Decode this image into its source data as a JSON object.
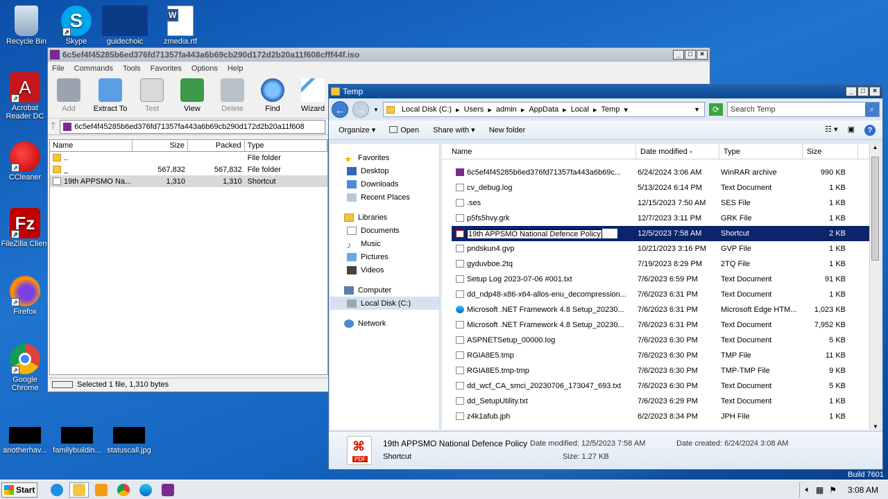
{
  "desktop": {
    "icons": [
      {
        "label": "Recycle Bin",
        "icon": "recycle-bin-icon"
      },
      {
        "label": "Skype",
        "icon": "skype-icon"
      },
      {
        "label": "guidechoic",
        "icon": "black-thumbnail"
      },
      {
        "label": "zmedia.rtf",
        "icon": "word-document-icon"
      },
      {
        "label": "Acrobat Reader DC",
        "icon": "acrobat-icon"
      },
      {
        "label": "CCleaner",
        "icon": "ccleaner-icon"
      },
      {
        "label": "FileZilla Client",
        "icon": "filezilla-icon"
      },
      {
        "label": "Firefox",
        "icon": "firefox-icon"
      },
      {
        "label": "Google Chrome",
        "icon": "chrome-icon"
      },
      {
        "label": "anotherhav...",
        "icon": "black-thumbnail"
      },
      {
        "label": "familybuildin...",
        "icon": "black-thumbnail"
      },
      {
        "label": "statuscall.jpg",
        "icon": "black-thumbnail"
      }
    ],
    "build": "Build 7601"
  },
  "winrar": {
    "title": "6c5ef4f45285b6ed376fd71357fa443a6b69cb290d172d2b20a11f608cfff44f.iso",
    "menu": [
      "File",
      "Commands",
      "Tools",
      "Favorites",
      "Options",
      "Help"
    ],
    "toolbar": [
      "Add",
      "Extract To",
      "Test",
      "View",
      "Delete",
      "Find",
      "Wizard"
    ],
    "path": "6c5ef4f45285b6ed376fd71357fa443a6b69cb290d172d2b20a11f608",
    "columns": [
      "Name",
      "Size",
      "Packed",
      "Type"
    ],
    "rows": [
      {
        "name": "..",
        "size": "",
        "packed": "",
        "type": "File folder"
      },
      {
        "name": "_",
        "size": "567,832",
        "packed": "567,832",
        "type": "File folder"
      },
      {
        "name": "19th APPSMO Na...",
        "size": "1,310",
        "packed": "1,310",
        "type": "Shortcut"
      }
    ],
    "status": "Selected 1 file, 1,310 bytes"
  },
  "explorer": {
    "title": "Temp",
    "breadcrumb": [
      "Local Disk (C:)",
      "Users",
      "admin",
      "AppData",
      "Local",
      "Temp"
    ],
    "search_placeholder": "Search Temp",
    "commands": [
      "Organize",
      "Open",
      "Share with",
      "New folder"
    ],
    "nav": {
      "favorites": "Favorites",
      "favorites_items": [
        "Desktop",
        "Downloads",
        "Recent Places"
      ],
      "libraries": "Libraries",
      "libraries_items": [
        "Documents",
        "Music",
        "Pictures",
        "Videos"
      ],
      "computer": "Computer",
      "computer_items": [
        "Local Disk (C:)"
      ],
      "network": "Network"
    },
    "columns": [
      "Name",
      "Date modified",
      "Type",
      "Size"
    ],
    "files": [
      {
        "name": "6c5ef4f45285b6ed376fd71357fa443a6b69c...",
        "date": "6/24/2024 3:06 AM",
        "type": "WinRAR archive",
        "size": "990 KB"
      },
      {
        "name": "cv_debug.log",
        "date": "5/13/2024 6:14 PM",
        "type": "Text Document",
        "size": "1 KB"
      },
      {
        "name": ".ses",
        "date": "12/15/2023 7:50 AM",
        "type": "SES File",
        "size": "1 KB"
      },
      {
        "name": "p5fs5hvy.grk",
        "date": "12/7/2023 3:11 PM",
        "type": "GRK File",
        "size": "1 KB"
      },
      {
        "name": "19th APPSMO National Defence Policy",
        "date": "12/5/2023 7:58 AM",
        "type": "Shortcut",
        "size": "2 KB"
      },
      {
        "name": "pndskun4.gvp",
        "date": "10/21/2023 3:16 PM",
        "type": "GVP File",
        "size": "1 KB"
      },
      {
        "name": "gyduvboe.2tq",
        "date": "7/19/2023 8:29 PM",
        "type": "2TQ File",
        "size": "1 KB"
      },
      {
        "name": "Setup Log 2023-07-06 #001.txt",
        "date": "7/6/2023 6:59 PM",
        "type": "Text Document",
        "size": "91 KB"
      },
      {
        "name": "dd_ndp48-x86-x64-allos-enu_decompression...",
        "date": "7/6/2023 6:31 PM",
        "type": "Text Document",
        "size": "1 KB"
      },
      {
        "name": "Microsoft .NET Framework 4.8 Setup_20230...",
        "date": "7/6/2023 6:31 PM",
        "type": "Microsoft Edge HTM...",
        "size": "1,023 KB"
      },
      {
        "name": "Microsoft .NET Framework 4.8 Setup_20230...",
        "date": "7/6/2023 6:31 PM",
        "type": "Text Document",
        "size": "7,952 KB"
      },
      {
        "name": "ASPNETSetup_00000.log",
        "date": "7/6/2023 6:30 PM",
        "type": "Text Document",
        "size": "5 KB"
      },
      {
        "name": "RGIA8E5.tmp",
        "date": "7/6/2023 6:30 PM",
        "type": "TMP File",
        "size": "11 KB"
      },
      {
        "name": "RGIA8E5.tmp-tmp",
        "date": "7/6/2023 6:30 PM",
        "type": "TMP-TMP File",
        "size": "9 KB"
      },
      {
        "name": "dd_wcf_CA_smci_20230706_173047_693.txt",
        "date": "7/6/2023 6:30 PM",
        "type": "Text Document",
        "size": "5 KB"
      },
      {
        "name": "dd_SetupUtility.txt",
        "date": "7/6/2023 6:29 PM",
        "type": "Text Document",
        "size": "1 KB"
      },
      {
        "name": "z4k1afub.jph",
        "date": "6/2/2023 8:34 PM",
        "type": "JPH File",
        "size": "1 KB"
      }
    ],
    "details": {
      "name": "19th APPSMO National Defence Policy",
      "type": "Shortcut",
      "modified_label": "Date modified:",
      "modified": "12/5/2023 7:58 AM",
      "created_label": "Date created:",
      "created": "6/24/2024 3:08 AM",
      "size_label": "Size:",
      "size": "1.27 KB",
      "icon_text": "PDF"
    }
  },
  "taskbar": {
    "start": "Start",
    "time": "3:08 AM"
  }
}
